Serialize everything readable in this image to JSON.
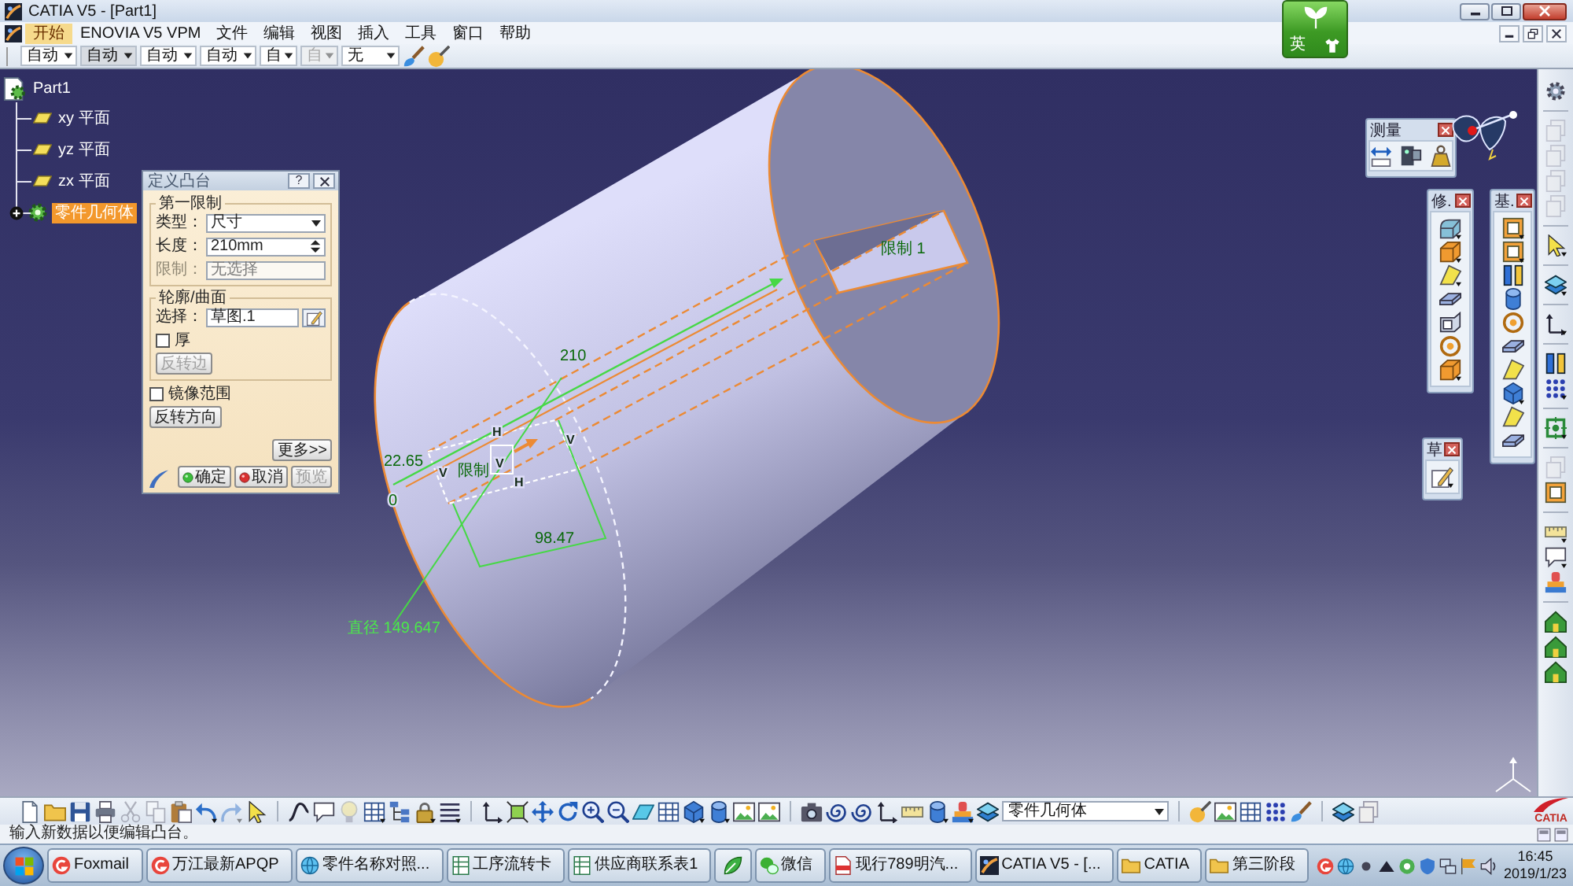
{
  "window": {
    "title": "CATIA V5 - [Part1]"
  },
  "menu_bar": {
    "items": [
      {
        "label": "开始",
        "selected": true
      },
      {
        "label": "ENOVIA V5 VPM",
        "selected": false
      },
      {
        "label": "文件",
        "selected": false
      },
      {
        "label": "编辑",
        "selected": false
      },
      {
        "label": "视图",
        "selected": false
      },
      {
        "label": "插入",
        "selected": false
      },
      {
        "label": "工具",
        "selected": false
      },
      {
        "label": "窗口",
        "selected": false
      },
      {
        "label": "帮助",
        "selected": false
      }
    ]
  },
  "toolbar": {
    "combos": [
      {
        "value": "自动",
        "highlighted": false,
        "disabled": false
      },
      {
        "value": "自动",
        "highlighted": true,
        "disabled": false
      },
      {
        "value": "自动",
        "highlighted": false,
        "disabled": false
      },
      {
        "value": "自动",
        "highlighted": false,
        "disabled": false
      },
      {
        "value": "自",
        "highlighted": false,
        "disabled": false
      },
      {
        "value": "自",
        "highlighted": false,
        "disabled": true
      },
      {
        "value": "无",
        "highlighted": false,
        "disabled": false
      }
    ]
  },
  "ime": {
    "label": "英"
  },
  "tree": {
    "root": {
      "label": "Part1",
      "kind": "part",
      "selected": false,
      "children": [
        {
          "label": "xy 平面",
          "kind": "plane",
          "selected": false,
          "collapsed": false
        },
        {
          "label": "yz 平面",
          "kind": "plane",
          "selected": false,
          "collapsed": false
        },
        {
          "label": "zx 平面",
          "kind": "plane",
          "selected": false,
          "collapsed": false
        },
        {
          "label": "零件几何体",
          "kind": "body",
          "selected": true,
          "collapsed": true
        }
      ]
    }
  },
  "dialog": {
    "title": "定义凸台",
    "help": "?",
    "first_limit": {
      "title": "第一限制",
      "rows": [
        {
          "kind": "combo",
          "label": "类型：",
          "value": "尺寸",
          "disabled": false
        },
        {
          "kind": "spinner",
          "label": "长度：",
          "value": "210mm",
          "disabled": false
        },
        {
          "kind": "field",
          "label": "限制：",
          "value": "无选择",
          "disabled": true
        }
      ]
    },
    "profile": {
      "title": "轮廓/曲面",
      "rows": [
        {
          "kind": "picker",
          "label": "选择：",
          "value": "草图.1",
          "disabled": false
        }
      ],
      "thick": {
        "label": "厚",
        "checked": false
      },
      "reverse_side": {
        "label": "反转边",
        "disabled": true
      }
    },
    "mirror": {
      "label": "镜像范围",
      "checked": false
    },
    "reverse_direction": {
      "label": "反转方向",
      "disabled": false
    },
    "more": "更多>>",
    "buttons": [
      {
        "kind": "ok",
        "label": "确定",
        "disabled": false
      },
      {
        "kind": "cancel",
        "label": "取消",
        "disabled": false
      },
      {
        "kind": "preview",
        "label": "预览",
        "disabled": true
      }
    ]
  },
  "measure_toolbar": {
    "title": "测量"
  },
  "floating_toolbars": [
    {
      "title": "修."
    },
    {
      "title": "基."
    },
    {
      "title": "草"
    }
  ],
  "model_labels": [
    {
      "text": "限制 1"
    },
    {
      "text": "210"
    },
    {
      "text": "22.65"
    },
    {
      "text": "0"
    },
    {
      "text": "限制"
    },
    {
      "text": "98.47"
    },
    {
      "text": "直径 149.647"
    }
  ],
  "constraint_marks": [
    {
      "label": "H"
    },
    {
      "label": "V"
    },
    {
      "label": "V"
    },
    {
      "label": "V"
    },
    {
      "label": "H"
    }
  ],
  "bottom_toolbar": {
    "combo": "零件几何体"
  },
  "logo": {
    "text": "CATIA"
  },
  "status_bar": {
    "message": "输入新数据以便编辑凸台。"
  },
  "taskbar": {
    "tasks": [
      {
        "label": "Foxmail",
        "kind": "swirl"
      },
      {
        "label": "万江最新APQP",
        "kind": "swirl"
      },
      {
        "label": "零件名称对照...",
        "kind": "browser"
      },
      {
        "label": "工序流转卡",
        "kind": "sheet"
      },
      {
        "label": "供应商联系表1",
        "kind": "sheet"
      },
      {
        "kind": "leaf"
      },
      {
        "label": "微信",
        "kind": "chat"
      },
      {
        "label": "现行789明汽...",
        "kind": "pdf"
      },
      {
        "label": "CATIA V5 - [...",
        "kind": "app"
      },
      {
        "label": "CATIA",
        "kind": "folder"
      },
      {
        "label": "第三阶段",
        "kind": "folder"
      }
    ],
    "clock": {
      "time": "16:45",
      "date": "2019/1/23"
    }
  }
}
